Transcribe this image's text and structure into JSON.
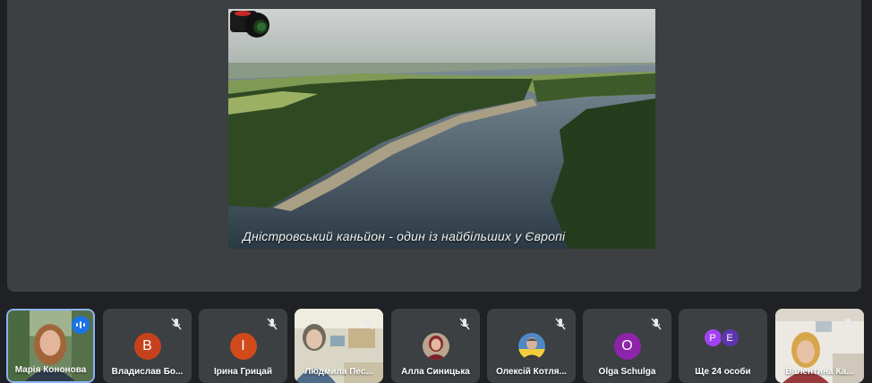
{
  "presentation": {
    "caption": "Дністровський каньйон - один із найбільших у Європі"
  },
  "participants": [
    {
      "name": "Марія Кононова",
      "kind": "video",
      "speaking": true
    },
    {
      "name": "Владислав Бо...",
      "kind": "letter",
      "initial": "B",
      "color": "#c5421d",
      "muted": true
    },
    {
      "name": "Ірина Грицай",
      "kind": "letter",
      "initial": "I",
      "color": "#d04a1b",
      "muted": true
    },
    {
      "name": "Людмила Пес...",
      "kind": "video",
      "muted": true
    },
    {
      "name": "Алла Синицька",
      "kind": "photo",
      "muted": true
    },
    {
      "name": "Олексій Котля...",
      "kind": "photo",
      "muted": true
    },
    {
      "name": "Olga Schulga",
      "kind": "letter",
      "initial": "O",
      "color": "#8e24aa",
      "muted": true
    },
    {
      "name": "Ще 24 особи",
      "kind": "group",
      "initials": [
        "P",
        "E"
      ],
      "colors": [
        "#a142f4",
        "#5e35b1"
      ]
    },
    {
      "name": "Валентина Ка...",
      "kind": "video",
      "muted": true
    }
  ],
  "icons": {
    "mute": "mic-off-icon",
    "speaking": "audio-wave-icon",
    "camera": "camera-icon"
  }
}
